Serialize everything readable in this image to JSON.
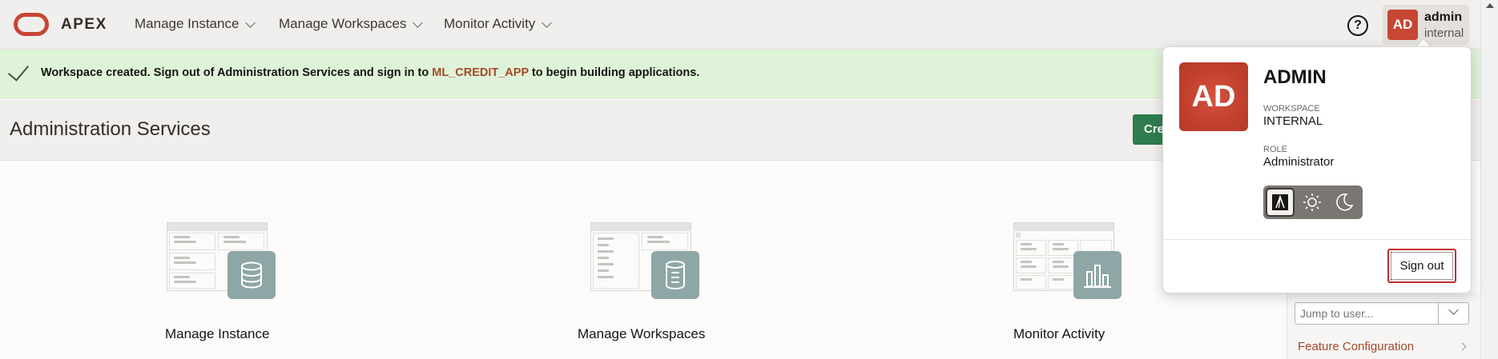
{
  "header": {
    "brand": "APEX",
    "nav": [
      {
        "label": "Manage Instance"
      },
      {
        "label": "Manage Workspaces"
      },
      {
        "label": "Monitor Activity"
      }
    ],
    "help_label": "?",
    "user": {
      "initials": "AD",
      "name": "admin",
      "workspace": "internal"
    }
  },
  "alert": {
    "text_before": "Workspace created. Sign out of Administration Services and sign in to ",
    "link_text": "ML_CREDIT_APP",
    "text_after": " to begin building applications."
  },
  "page": {
    "title": "Administration Services",
    "create_button": "Cre"
  },
  "cards": [
    {
      "label": "Manage Instance",
      "icon": "database-icon"
    },
    {
      "label": "Manage Workspaces",
      "icon": "cylinder-list-icon"
    },
    {
      "label": "Monitor Activity",
      "icon": "bar-chart-icon"
    }
  ],
  "right_panel": {
    "jump_placeholder": "Jump to user...",
    "feature_link": "Feature Configuration"
  },
  "profile_popup": {
    "initials": "AD",
    "name": "ADMIN",
    "workspace_label": "WORKSPACE",
    "workspace_value": "INTERNAL",
    "role_label": "ROLE",
    "role_value": "Administrator",
    "theme_options": [
      "auto-icon",
      "sun-icon",
      "moon-icon"
    ],
    "selected_theme": "auto-icon",
    "signout_label": "Sign out"
  },
  "colors": {
    "brand_red": "#c74634",
    "success_bg": "#dff3d8",
    "link": "#a54a2a",
    "primary_green": "#2f7d4f",
    "tile_teal": "#8ea6a6"
  }
}
